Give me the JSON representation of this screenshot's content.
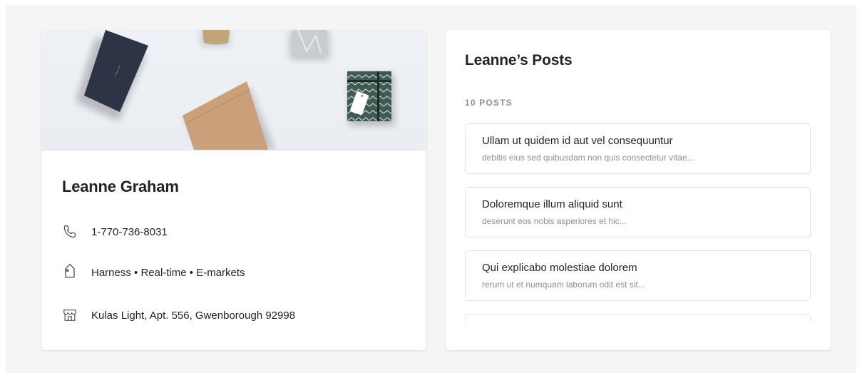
{
  "profile": {
    "name": "Leanne Graham",
    "phone": "1-770-736-8031",
    "tags": "Harness • Real-time • E-markets",
    "address": "Kulas Light, Apt. 556, Gwenborough 92998",
    "icons": {
      "phone": "phone-icon",
      "tags": "tag-icon",
      "address": "store-icon"
    }
  },
  "posts": {
    "title": "Leanne’s Posts",
    "count_label": "10 POSTS",
    "items": [
      {
        "title": "Ullam ut quidem id aut vel consequuntur",
        "excerpt": "debitis eius sed quibusdam non quis consectetur vitae..."
      },
      {
        "title": "Doloremque illum aliquid sunt",
        "excerpt": "deserunt eos nobis asperiores et hic..."
      },
      {
        "title": "Qui explicabo molestiae dolorem",
        "excerpt": "rerum ut et numquam laborum odit est sit..."
      },
      {
        "title": "",
        "excerpt": ""
      }
    ]
  },
  "colors": {
    "page_bg": "#f5f5f6",
    "card_bg": "#ffffff",
    "text_primary": "#1f2328",
    "text_muted": "#8b9098",
    "border": "#dfe3e9"
  }
}
